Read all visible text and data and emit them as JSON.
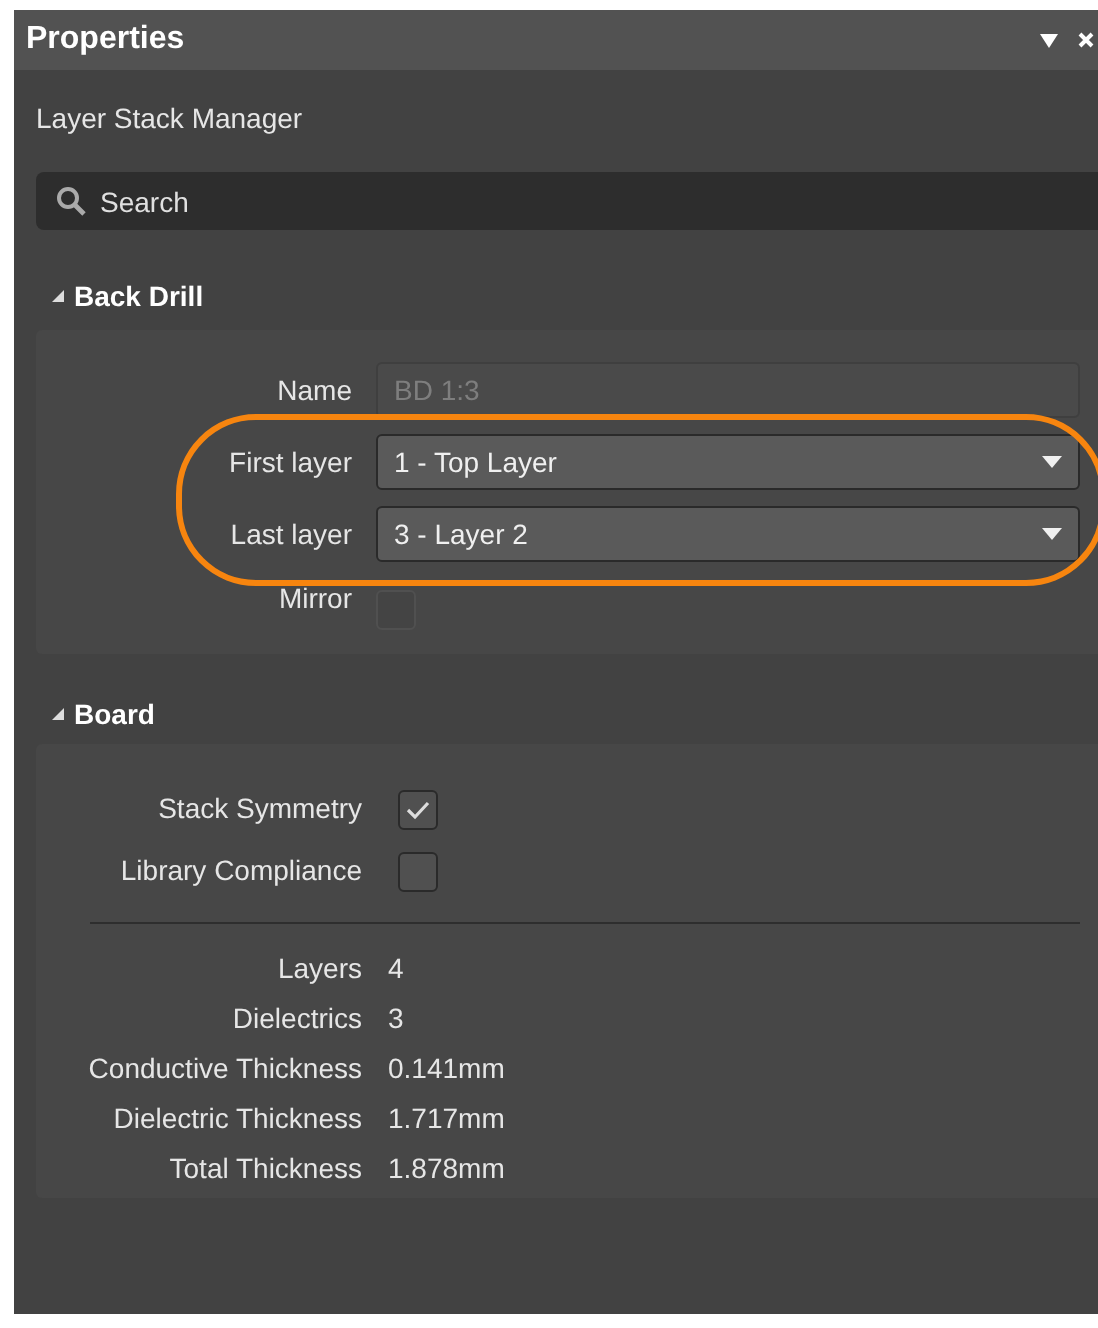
{
  "panel": {
    "title": "Properties",
    "subtitle": "Layer Stack Manager",
    "search": {
      "placeholder": "Search"
    }
  },
  "back_drill": {
    "title": "Back Drill",
    "expanded": true,
    "name": {
      "label": "Name",
      "value": "BD 1:3",
      "disabled": true
    },
    "first_layer": {
      "label": "First layer",
      "value": "1 - Top Layer"
    },
    "last_layer": {
      "label": "Last layer",
      "value": "3 - Layer 2"
    },
    "mirror": {
      "label": "Mirror",
      "checked": false,
      "disabled": true
    }
  },
  "board": {
    "title": "Board",
    "expanded": true,
    "options": [
      {
        "label": "Stack Symmetry",
        "checked": true
      },
      {
        "label": "Library Compliance",
        "checked": false
      }
    ],
    "stats": [
      {
        "label": "Layers",
        "value": "4"
      },
      {
        "label": "Dielectrics",
        "value": "3"
      },
      {
        "label": "Conductive Thickness",
        "value": "0.141mm"
      },
      {
        "label": "Dielectric Thickness",
        "value": "1.717mm"
      },
      {
        "label": "Total Thickness",
        "value": "1.878mm"
      }
    ]
  }
}
